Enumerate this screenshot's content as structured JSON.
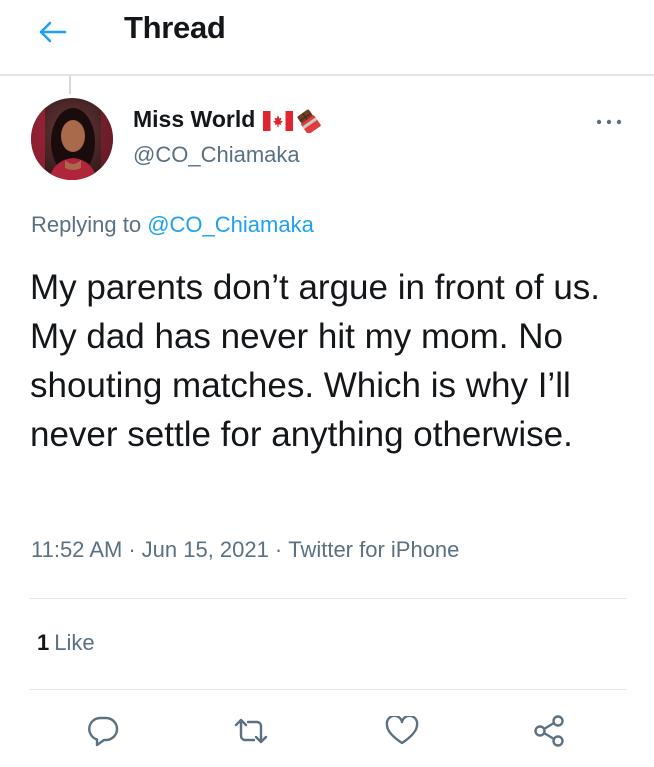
{
  "header": {
    "back_icon": "arrow-left-icon",
    "title": "Thread",
    "accent_color": "#1da1f2"
  },
  "tweet": {
    "author": {
      "display_name": "Miss World",
      "emoji": [
        "canada-flag-icon",
        "chocolate-bar-icon"
      ],
      "handle": "@CO_Chiamaka"
    },
    "replying_label": "Replying to",
    "replying_to": "@CO_Chiamaka",
    "text": "My parents don’t argue in front of us. My dad has never hit my mom. No shouting matches. Which is why I’ll never settle for anything otherwise.",
    "time": "11:52 AM",
    "date": "Jun 15, 2021",
    "source": "Twitter for iPhone",
    "separator": "·",
    "like_count": "1",
    "like_label": "Like"
  },
  "actions": [
    {
      "icon": "reply-icon"
    },
    {
      "icon": "retweet-icon"
    },
    {
      "icon": "heart-icon"
    },
    {
      "icon": "share-icon"
    }
  ]
}
